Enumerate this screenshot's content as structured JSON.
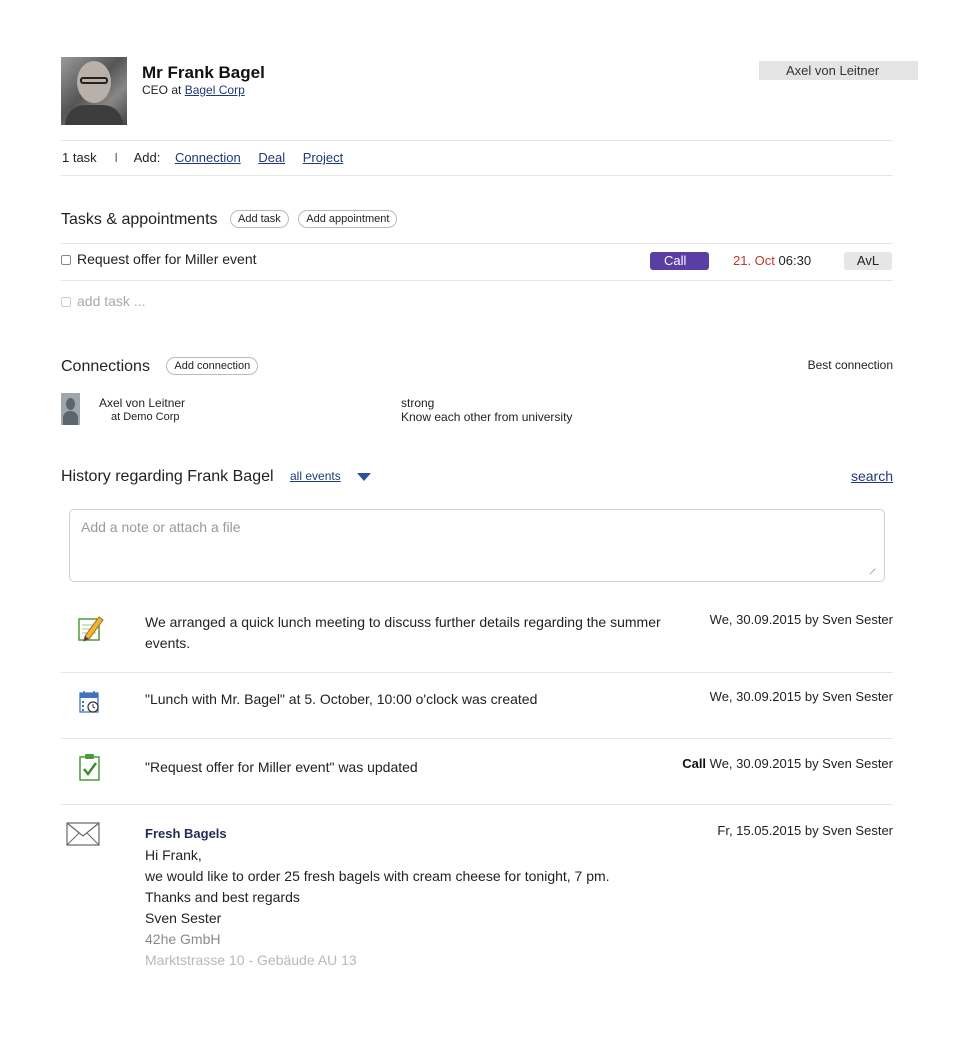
{
  "header": {
    "owner": "Axel von Leitner",
    "name": "Mr Frank Bagel",
    "title_prefix": "CEO at",
    "company": "Bagel Corp"
  },
  "addbar": {
    "task_count": "1 task",
    "separator": "I",
    "add_label": "Add:",
    "links": [
      "Connection",
      "Deal",
      "Project"
    ]
  },
  "tasks": {
    "heading": "Tasks & appointments",
    "add_task": "Add task",
    "add_appointment": "Add appointment",
    "items": [
      {
        "label": "Request offer for Miller event",
        "type": "Call",
        "date": "21. Oct",
        "time": "06:30",
        "assignee": "AvL"
      }
    ],
    "add_placeholder": "add task ..."
  },
  "connections": {
    "heading": "Connections",
    "add_connection": "Add connection",
    "best_label": "Best connection",
    "items": [
      {
        "name": "Axel von Leitner",
        "company": "at Demo Corp",
        "strength": "strong",
        "note": "Know each other from university"
      }
    ]
  },
  "history": {
    "heading": "History regarding Frank Bagel",
    "filter": "all events",
    "search": "search",
    "note_placeholder": "Add a note or attach a file",
    "events": [
      {
        "icon": "pencil-note-icon",
        "text": "We arranged a quick lunch meeting to discuss further details regarding the summer events.",
        "tag": "",
        "meta": "We, 30.09.2015 by Sven Sester"
      },
      {
        "icon": "calendar-clock-icon",
        "text": "\"Lunch with Mr. Bagel\" at 5. October, 10:00 o'clock was created",
        "tag": "",
        "meta": "We, 30.09.2015 by Sven Sester"
      },
      {
        "icon": "task-check-icon",
        "text": "\"Request offer for Miller event\" was updated",
        "tag": "Call",
        "meta": "We, 30.09.2015 by Sven Sester"
      }
    ],
    "mail": {
      "icon": "envelope-icon",
      "subject": "Fresh Bagels",
      "meta": "Fr, 15.05.2015 by Sven Sester",
      "lines": [
        "Hi Frank,",
        "we would like to order 25 fresh bagels with cream cheese for tonight, 7 pm.",
        "Thanks and best regards",
        "Sven Sester"
      ],
      "signature": [
        "42he GmbH",
        "Marktstrasse 10 - Gebäude AU 13"
      ]
    }
  }
}
